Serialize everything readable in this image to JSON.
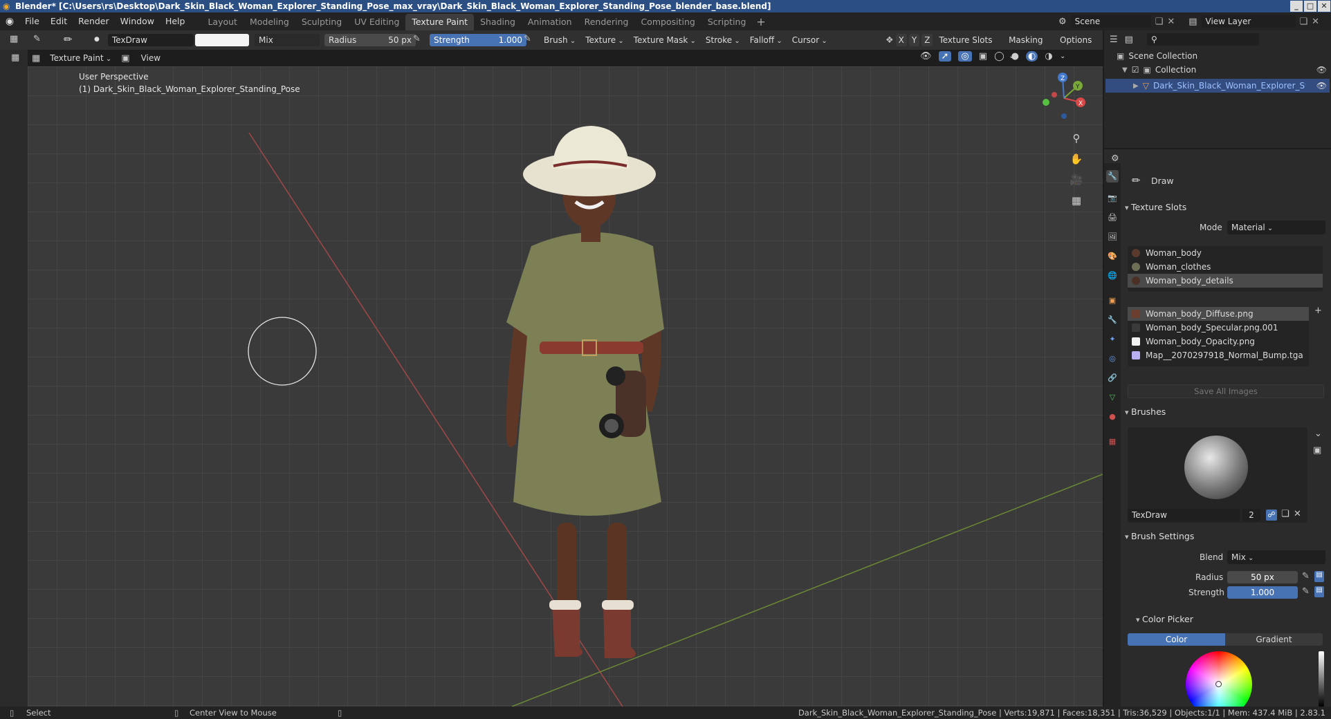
{
  "window": {
    "title": "Blender* [C:\\Users\\rs\\Desktop\\Dark_Skin_Black_Woman_Explorer_Standing_Pose_max_vray\\Dark_Skin_Black_Woman_Explorer_Standing_Pose_blender_base.blend]",
    "controls": [
      "_",
      "□",
      "✕"
    ]
  },
  "menu": [
    "File",
    "Edit",
    "Render",
    "Window",
    "Help"
  ],
  "workspaces": [
    "Layout",
    "Modeling",
    "Sculpting",
    "UV Editing",
    "Texture Paint",
    "Shading",
    "Animation",
    "Rendering",
    "Compositing",
    "Scripting"
  ],
  "active_workspace": "Texture Paint",
  "scene": {
    "name": "Scene",
    "view_layer": "View Layer"
  },
  "tool_header": {
    "brush_name": "TexDraw",
    "blend": "Mix",
    "radius_label": "Radius",
    "radius_value": "50 px",
    "strength_label": "Strength",
    "strength_value": "1.000",
    "dropdowns": [
      "Brush",
      "Texture",
      "Texture Mask",
      "Stroke",
      "Falloff",
      "Cursor"
    ],
    "axes": [
      "X",
      "Y",
      "Z"
    ],
    "right_dropdowns": [
      "Texture Slots",
      "Masking",
      "Options"
    ]
  },
  "view_header": {
    "mode": "Texture Paint",
    "view": "View"
  },
  "viewport": {
    "perspective": "User Perspective",
    "object_label": "(1) Dark_Skin_Black_Woman_Explorer_Standing_Pose"
  },
  "outliner": {
    "root": "Scene Collection",
    "collection": "Collection",
    "object": "Dark_Skin_Black_Woman_Explorer_Standing_Pose"
  },
  "properties": {
    "tool_name": "Draw",
    "texture_slots": {
      "title": "Texture Slots",
      "mode_label": "Mode",
      "mode_value": "Material",
      "materials": [
        "Woman_body",
        "Woman_clothes",
        "Woman_body_details"
      ],
      "images": [
        "Woman_body_Diffuse.png",
        "Woman_body_Specular.png.001",
        "Woman_body_Opacity.png",
        "Map__2070297918_Normal_Bump.tga"
      ],
      "save_all": "Save All Images"
    },
    "brushes": {
      "title": "Brushes",
      "brush_name": "TexDraw",
      "users": "2"
    },
    "brush_settings": {
      "title": "Brush Settings",
      "blend_label": "Blend",
      "blend_value": "Mix",
      "radius_label": "Radius",
      "radius_value": "50 px",
      "strength_label": "Strength",
      "strength_value": "1.000"
    },
    "color_picker": {
      "title": "Color Picker",
      "tabs": [
        "Color",
        "Gradient"
      ]
    }
  },
  "status": {
    "select": "Select",
    "center": "Center View to Mouse",
    "stats": "Dark_Skin_Black_Woman_Explorer_Standing_Pose | Verts:19,871 | Faces:18,351 | Tris:36,529 | Objects:1/1 | Mem: 437.4 MiB | 2.83.1"
  },
  "colors": {
    "accent": "#4772b3",
    "active_tab": "#3d3d3d",
    "header": "#303030",
    "viewport": "#3a3a3a"
  },
  "icons": [
    "blender-logo-icon",
    "brush-icon",
    "drop-icon",
    "smear-icon",
    "stamp-icon",
    "fill-icon",
    "mask-icon",
    "annotate-icon",
    "zoom-icon",
    "hand-icon",
    "camera-icon",
    "grid-icon",
    "eye-icon",
    "search-icon",
    "filter-icon"
  ]
}
